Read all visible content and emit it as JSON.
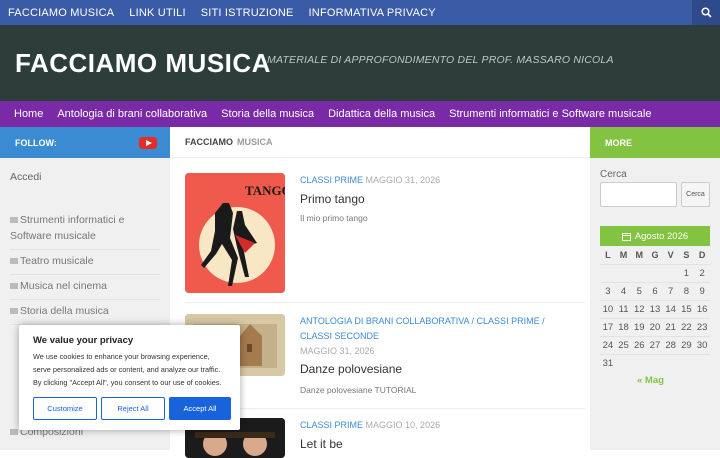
{
  "topbar": {
    "items": [
      "FACCIAMO MUSICA",
      "LINK UTILI",
      "SITI ISTRUZIONE",
      "INFORMATIVA PRIVACY"
    ]
  },
  "header": {
    "title": "FACCIAMO MUSICA",
    "tagline": "MATERIALE DI APPROFONDIMENTO DEL PROF. MASSARO NICOLA"
  },
  "mainnav": {
    "items": [
      "Home",
      "Antologia di brani collaborativa",
      "Storia della musica",
      "Didattica della musica",
      "Strumenti informatici e Software musicale"
    ]
  },
  "left": {
    "follow_label": "FOLLOW:",
    "accedi": "Accedi",
    "categories": [
      "Strumenti informatici e Software musicale",
      "Teatro musicale",
      "Musica nel cinema",
      "Storia della musica",
      "Composizioni"
    ]
  },
  "content": {
    "crumb_a": "FACCIAMO",
    "crumb_b": "MUSICA",
    "posts": [
      {
        "meta": "CLASSI PRIME",
        "date": "MAGGIO 31, 2026",
        "title": "Primo tango",
        "excerpt": "Il mio primo tango"
      },
      {
        "meta": "ANTOLOGIA DI BRANI COLLABORATIVA / CLASSI PRIME / CLASSI SECONDE",
        "date": "MAGGIO 31, 2026",
        "title": "Danze polovesiane",
        "excerpt": "Danze polovesiane TUTORIAL"
      },
      {
        "meta": "CLASSI PRIME",
        "date": "MAGGIO 10, 2026",
        "title": "Let it be",
        "excerpt": ""
      }
    ],
    "thumb1_text": "TANGO"
  },
  "right": {
    "more_label": "MORE",
    "search_label": "Cerca",
    "search_button": "Cerca",
    "calendar": {
      "month": "Agosto 2026",
      "days": [
        "L",
        "M",
        "M",
        "G",
        "V",
        "S",
        "D"
      ],
      "weeks": [
        [
          "",
          "",
          "",
          "",
          "",
          "1",
          "2"
        ],
        [
          "3",
          "4",
          "5",
          "6",
          "7",
          "8",
          "9"
        ],
        [
          "10",
          "11",
          "12",
          "13",
          "14",
          "15",
          "16"
        ],
        [
          "17",
          "18",
          "19",
          "20",
          "21",
          "22",
          "23"
        ],
        [
          "24",
          "25",
          "26",
          "27",
          "28",
          "29",
          "30"
        ],
        [
          "31",
          "",
          "",
          "",
          "",
          "",
          ""
        ]
      ],
      "prev": "« Mag"
    }
  },
  "cookie": {
    "title": "We value your privacy",
    "text": "We use cookies to enhance your browsing experience, serve personalized ads or content, and analyze our traffic. By clicking \"Accept All\", you consent to our use of cookies.",
    "customize": "Customize",
    "reject": "Reject All",
    "accept": "Accept All"
  }
}
